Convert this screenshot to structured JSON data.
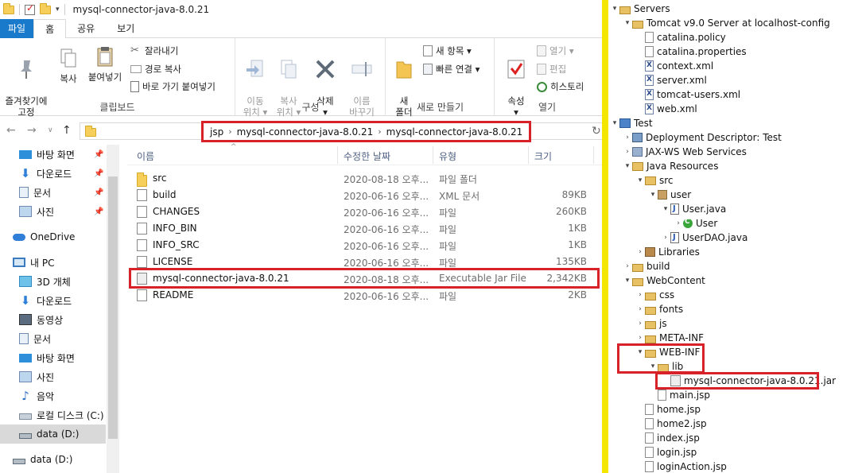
{
  "explorer": {
    "title": "mysql-connector-java-8.0.21",
    "tabs": [
      {
        "label": "파일",
        "kind": "file"
      },
      {
        "label": "홈",
        "kind": "active"
      },
      {
        "label": "공유",
        "kind": "normal"
      },
      {
        "label": "보기",
        "kind": "normal"
      }
    ],
    "ribbon": {
      "clipboard": {
        "group_label": "클립보드",
        "pin_quick_access": "즐겨찾기에\n고정",
        "copy": "복사",
        "paste": "붙여넣기",
        "cut": "잘라내기",
        "copy_path": "경로 복사",
        "paste_shortcut": "바로 가기 붙여넣기"
      },
      "organize": {
        "group_label": "구성",
        "move_to": "이동\n위치 ▾",
        "copy_to": "복사\n위치 ▾",
        "delete": "삭제\n▾",
        "rename": "이름\n바꾸기"
      },
      "new": {
        "group_label": "새로 만들기",
        "new_folder": "새\n폴더",
        "new_item": "새 항목 ▾",
        "easy_access": "빠른 연결 ▾"
      },
      "open": {
        "group_label": "열기",
        "properties": "속성\n▾",
        "open": "열기 ▾",
        "edit": "편집",
        "history": "히스토리"
      }
    },
    "breadcrumbs": [
      "jsp",
      "mysql-connector-java-8.0.21",
      "mysql-connector-java-8.0.21"
    ],
    "nav_items": [
      {
        "label": "바탕 화면",
        "icon": "desktop-icon",
        "pinned": true
      },
      {
        "label": "다운로드",
        "icon": "download-icon",
        "pinned": true
      },
      {
        "label": "문서",
        "icon": "document-icon",
        "pinned": true
      },
      {
        "label": "사진",
        "icon": "pictures-icon",
        "pinned": true
      },
      {
        "label": "OneDrive",
        "icon": "onedrive-icon",
        "pinned": false
      },
      {
        "label": "내 PC",
        "icon": "pc-icon",
        "pinned": false
      },
      {
        "label": "3D 개체",
        "icon": "3d-objects-icon",
        "pinned": false
      },
      {
        "label": "다운로드",
        "icon": "download-icon",
        "pinned": false
      },
      {
        "label": "동영상",
        "icon": "video-icon",
        "pinned": false
      },
      {
        "label": "문서",
        "icon": "document-icon",
        "pinned": false
      },
      {
        "label": "바탕 화면",
        "icon": "desktop-icon",
        "pinned": false
      },
      {
        "label": "사진",
        "icon": "pictures-icon",
        "pinned": false
      },
      {
        "label": "음악",
        "icon": "music-icon",
        "pinned": false
      },
      {
        "label": "로컬 디스크 (C:)",
        "icon": "local-disk-icon",
        "pinned": false
      },
      {
        "label": "data (D:)",
        "icon": "drive-icon",
        "pinned": false,
        "selected": true
      },
      {
        "label": "data (D:)",
        "icon": "drive-icon",
        "pinned": false
      }
    ],
    "columns": {
      "name": "이름",
      "date": "수정한 날짜",
      "type": "유형",
      "size": "크기"
    },
    "files": [
      {
        "name": "src",
        "date": "2020-08-18 오후...",
        "type": "파일 폴더",
        "size": "",
        "icon": "folder-icon"
      },
      {
        "name": "build",
        "date": "2020-06-16 오후...",
        "type": "XML 문서",
        "size": "89KB",
        "icon": "xml-file-icon"
      },
      {
        "name": "CHANGES",
        "date": "2020-06-16 오후...",
        "type": "파일",
        "size": "260KB",
        "icon": "file-icon"
      },
      {
        "name": "INFO_BIN",
        "date": "2020-06-16 오후...",
        "type": "파일",
        "size": "1KB",
        "icon": "file-icon"
      },
      {
        "name": "INFO_SRC",
        "date": "2020-06-16 오후...",
        "type": "파일",
        "size": "1KB",
        "icon": "file-icon"
      },
      {
        "name": "LICENSE",
        "date": "2020-06-16 오후...",
        "type": "파일",
        "size": "135KB",
        "icon": "file-icon"
      },
      {
        "name": "mysql-connector-java-8.0.21",
        "date": "2020-08-18 오후...",
        "type": "Executable Jar File",
        "size": "2,342KB",
        "icon": "jar-file-icon"
      },
      {
        "name": "README",
        "date": "2020-06-16 오후...",
        "type": "파일",
        "size": "2KB",
        "icon": "file-icon"
      }
    ]
  },
  "project_tree": [
    {
      "label": "Servers",
      "depth": 0,
      "arrow": "▾",
      "icon": "folder"
    },
    {
      "label": "Tomcat v9.0 Server at localhost-config",
      "depth": 1,
      "arrow": "▾",
      "icon": "folder"
    },
    {
      "label": "catalina.policy",
      "depth": 2,
      "arrow": "",
      "icon": "file"
    },
    {
      "label": "catalina.properties",
      "depth": 2,
      "arrow": "",
      "icon": "file"
    },
    {
      "label": "context.xml",
      "depth": 2,
      "arrow": "",
      "icon": "xml"
    },
    {
      "label": "server.xml",
      "depth": 2,
      "arrow": "",
      "icon": "xml"
    },
    {
      "label": "tomcat-users.xml",
      "depth": 2,
      "arrow": "",
      "icon": "xml"
    },
    {
      "label": "web.xml",
      "depth": 2,
      "arrow": "",
      "icon": "xml"
    },
    {
      "label": "Test",
      "depth": 0,
      "arrow": "▾",
      "icon": "project"
    },
    {
      "label": "Deployment Descriptor: Test",
      "depth": 1,
      "arrow": "›",
      "icon": "dd"
    },
    {
      "label": "JAX-WS Web Services",
      "depth": 1,
      "arrow": "›",
      "icon": "ws"
    },
    {
      "label": "Java Resources",
      "depth": 1,
      "arrow": "▾",
      "icon": "srcf"
    },
    {
      "label": "src",
      "depth": 2,
      "arrow": "▾",
      "icon": "srcf"
    },
    {
      "label": "user",
      "depth": 3,
      "arrow": "▾",
      "icon": "pkg"
    },
    {
      "label": "User.java",
      "depth": 4,
      "arrow": "▾",
      "icon": "java"
    },
    {
      "label": "User",
      "depth": 5,
      "arrow": "›",
      "icon": "class"
    },
    {
      "label": "UserDAO.java",
      "depth": 4,
      "arrow": "›",
      "icon": "java"
    },
    {
      "label": "Libraries",
      "depth": 2,
      "arrow": "›",
      "icon": "lib"
    },
    {
      "label": "build",
      "depth": 1,
      "arrow": "›",
      "icon": "folder"
    },
    {
      "label": "WebContent",
      "depth": 1,
      "arrow": "▾",
      "icon": "folder"
    },
    {
      "label": "css",
      "depth": 2,
      "arrow": "›",
      "icon": "folder"
    },
    {
      "label": "fonts",
      "depth": 2,
      "arrow": "›",
      "icon": "folder"
    },
    {
      "label": "js",
      "depth": 2,
      "arrow": "›",
      "icon": "folder"
    },
    {
      "label": "META-INF",
      "depth": 2,
      "arrow": "›",
      "icon": "folder"
    },
    {
      "label": "WEB-INF",
      "depth": 2,
      "arrow": "▾",
      "icon": "folder"
    },
    {
      "label": "lib",
      "depth": 3,
      "arrow": "▾",
      "icon": "folder"
    },
    {
      "label": "mysql-connector-java-8.0.21.jar",
      "depth": 4,
      "arrow": "",
      "icon": "jar"
    },
    {
      "label": "main.jsp",
      "depth": 3,
      "arrow": "",
      "icon": "jsp"
    },
    {
      "label": "home.jsp",
      "depth": 2,
      "arrow": "",
      "icon": "jsp"
    },
    {
      "label": "home2.jsp",
      "depth": 2,
      "arrow": "",
      "icon": "jsp"
    },
    {
      "label": "index.jsp",
      "depth": 2,
      "arrow": "",
      "icon": "jsp"
    },
    {
      "label": "login.jsp",
      "depth": 2,
      "arrow": "",
      "icon": "jsp"
    },
    {
      "label": "loginAction.jsp",
      "depth": 2,
      "arrow": "",
      "icon": "jsp"
    }
  ],
  "colors": {
    "highlight": "#d8222a",
    "separator": "#f3e600",
    "ribbon_file_tab": "#1979ca"
  }
}
